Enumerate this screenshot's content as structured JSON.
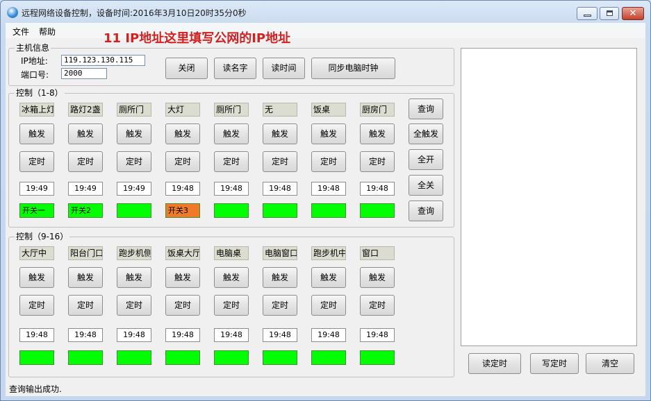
{
  "window": {
    "title": "远程网络设备控制，设备时间:2016年3月10日20时35分0秒",
    "icon": "app-globe-icon",
    "close_glyph": "✕"
  },
  "menu": [
    "文件",
    "帮助"
  ],
  "annotation": "11 IP地址这里填写公网的IP地址",
  "host": {
    "legend": "主机信息",
    "ip_label": "IP地址:",
    "ip_value": "119.123.130.115",
    "port_label": "端口号:",
    "port_value": "2000",
    "buttons": [
      "关闭",
      "读名字",
      "读时间",
      "同步电脑时钟"
    ]
  },
  "group1": {
    "legend": "控制（1-8）",
    "names": [
      "冰箱上灯",
      "路灯2盏",
      "厕所门",
      "大灯",
      "厕所门",
      "无",
      "饭桌",
      "厨房门"
    ],
    "trigger_label": "触发",
    "timer_label": "定时",
    "times": [
      "19:49",
      "19:49",
      "19:49",
      "19:48",
      "19:48",
      "19:48",
      "19:48",
      "19:48"
    ],
    "statuses": [
      {
        "text": "开关一",
        "color": "#00ff00"
      },
      {
        "text": "开关2",
        "color": "#00ff00"
      },
      {
        "text": "",
        "color": "#00ff00"
      },
      {
        "text": "开关3",
        "color": "#f07a2a"
      },
      {
        "text": "",
        "color": "#00ff00"
      },
      {
        "text": "",
        "color": "#00ff00"
      },
      {
        "text": "",
        "color": "#00ff00"
      },
      {
        "text": "",
        "color": "#00ff00"
      }
    ],
    "side_buttons": [
      "查询",
      "全触发",
      "全开",
      "全关",
      "查询"
    ]
  },
  "group2": {
    "legend": "控制（9-16）",
    "names": [
      "大厅中",
      "阳台门口",
      "跑步机侧",
      "饭桌大厅",
      "电脑桌",
      "电脑窗口",
      "跑步机中",
      "窗口"
    ],
    "trigger_label": "触发",
    "timer_label": "定时",
    "times": [
      "19:48",
      "19:48",
      "19:48",
      "19:48",
      "19:48",
      "19:48",
      "19:48",
      "19:48"
    ],
    "status_color": "#00ff00"
  },
  "right_buttons": [
    "读定时",
    "写定时",
    "清空"
  ],
  "status_text": "查询输出成功."
}
